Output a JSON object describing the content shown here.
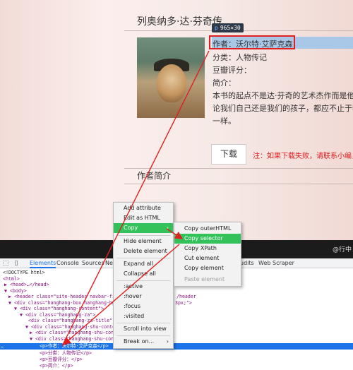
{
  "page": {
    "book_title": "列奥纳多·达·芬奇传",
    "tooltip_tag": "p",
    "tooltip_size": "965×30",
    "author": "作者：沃尔特·艾萨克森",
    "category": "分类：人物传记",
    "douban_rating": "豆瓣评分：",
    "intro_label": "简介：",
    "description_line1": "本书的起点不是达·芬奇的艺术杰作而是他令人震",
    "description_line2": "论我们自己还是我们的孩子，都应不止于吸收知",
    "description_line3": "一样。",
    "download_button": "下载",
    "download_note": "注：如果下载失败，请联系小编，",
    "author_intro_heading": "作者简介",
    "corner_text": "@行中"
  },
  "devtools": {
    "tabs": [
      "Elements",
      "Console",
      "Sources",
      "Ne",
      "udits",
      "Web Scraper"
    ],
    "dom_lines": [
      {
        "indent": 1,
        "text": "<!DOCTYPE html>"
      },
      {
        "indent": 1,
        "text": "<html>"
      },
      {
        "indent": 2,
        "text": "▶ <head>…</head>"
      },
      {
        "indent": 2,
        "text": "▼ <body>"
      },
      {
        "indent": 3,
        "text": "▶ <header class=\"site-header navbar-fi"
      },
      {
        "indent": 3,
        "text": "▼ <div class=\"hanghang-box hanghang-bg"
      },
      {
        "indent": 4,
        "text": "▼ <div class=\"hanghang-content\">"
      },
      {
        "indent": 5,
        "text": "▼ <div class=\"hanghang-za\">"
      },
      {
        "indent": 6,
        "text": "<div class=\"hanghang-za-title\""
      },
      {
        "indent": 6,
        "text": "▼ <div class=\"hanghang-shu-conten"
      },
      {
        "indent": 7,
        "text": "▶ <div class=\"hanghang-shu-cont"
      },
      {
        "indent": 7,
        "text": "▼ <div class=\"hanghang-shu-cont"
      },
      {
        "indent": 8,
        "text": "<p>作者：沃尔特·艾萨克森</p>",
        "selected": true
      },
      {
        "indent": 8,
        "text": "<p>分类：人物传记</p>"
      },
      {
        "indent": 8,
        "text": "<p>豆瓣评分：</p>"
      },
      {
        "indent": 8,
        "text": "<p>简介：</p>"
      }
    ],
    "right_fragments": [
      "/header",
      "3px;\">"
    ],
    "selected_gutter": "…"
  },
  "context_menu": {
    "items": [
      "Add attribute",
      "Edit as HTML",
      "Copy",
      "Hide element",
      "Delete element",
      "Expand all",
      "Collapse all",
      ":active",
      ":hover",
      ":focus",
      ":visited",
      "Scroll into view",
      "Break on..."
    ],
    "copy_arrow": "›",
    "break_arrow": "›"
  },
  "sub_menu": {
    "items": [
      "Copy outerHTML",
      "Copy selector",
      "Copy XPath",
      "Cut element",
      "Copy element",
      "Paste element"
    ]
  },
  "colors": {
    "highlight_red": "#e02020",
    "menu_active_green": "#33c15a",
    "devtools_selection_blue": "#1a73e8"
  }
}
